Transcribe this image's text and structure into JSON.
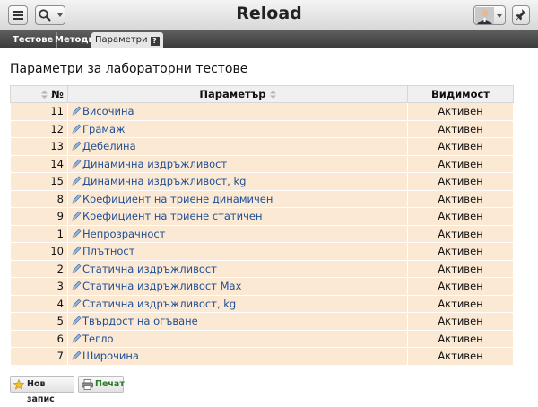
{
  "app": {
    "title": "Reload"
  },
  "icons": {
    "menu": "hamburger-icon",
    "search": "magnifier-icon",
    "avatar": "user-avatar",
    "pin": "pin-icon",
    "help": "help-icon",
    "edit": "pencil-icon",
    "new": "star-icon",
    "print": "printer-icon"
  },
  "tabs": [
    {
      "label": "Тестове",
      "active": false
    },
    {
      "label": "Методи",
      "active": false
    },
    {
      "label": "Параметри",
      "active": true
    }
  ],
  "tab_help": "?",
  "page": {
    "heading": "Параметри за лабораторни тестове"
  },
  "table": {
    "headers": {
      "num": "№",
      "name": "Параметър",
      "visibility": "Видимост"
    },
    "rows": [
      {
        "num": "11",
        "name": "Височина",
        "visibility": "Активен"
      },
      {
        "num": "12",
        "name": "Грамаж",
        "visibility": "Активен"
      },
      {
        "num": "13",
        "name": "Дебелина",
        "visibility": "Активен"
      },
      {
        "num": "14",
        "name": "Динамична издръжливост",
        "visibility": "Активен"
      },
      {
        "num": "15",
        "name": "Динамична издръжливост, kg",
        "visibility": "Активен"
      },
      {
        "num": "8",
        "name": "Коефициент на триене динамичен",
        "visibility": "Активен"
      },
      {
        "num": "9",
        "name": "Коефициент на триене статичен",
        "visibility": "Активен"
      },
      {
        "num": "1",
        "name": "Непрозрачност",
        "visibility": "Активен"
      },
      {
        "num": "10",
        "name": "Плътност",
        "visibility": "Активен"
      },
      {
        "num": "2",
        "name": "Статична издръжливост",
        "visibility": "Активен"
      },
      {
        "num": "3",
        "name": "Статична издръжливост Max",
        "visibility": "Активен"
      },
      {
        "num": "4",
        "name": "Статична издръжливост, kg",
        "visibility": "Активен"
      },
      {
        "num": "5",
        "name": "Твърдост на огъване",
        "visibility": "Активен"
      },
      {
        "num": "6",
        "name": "Тегло",
        "visibility": "Активен"
      },
      {
        "num": "7",
        "name": "Широчина",
        "visibility": "Активен"
      }
    ]
  },
  "actions": {
    "new_label": "Нов запис",
    "print_label": "Печат"
  },
  "colors": {
    "row_bg": "#fce9d4",
    "link": "#1f4f94",
    "print_text": "#2a7a2a"
  }
}
